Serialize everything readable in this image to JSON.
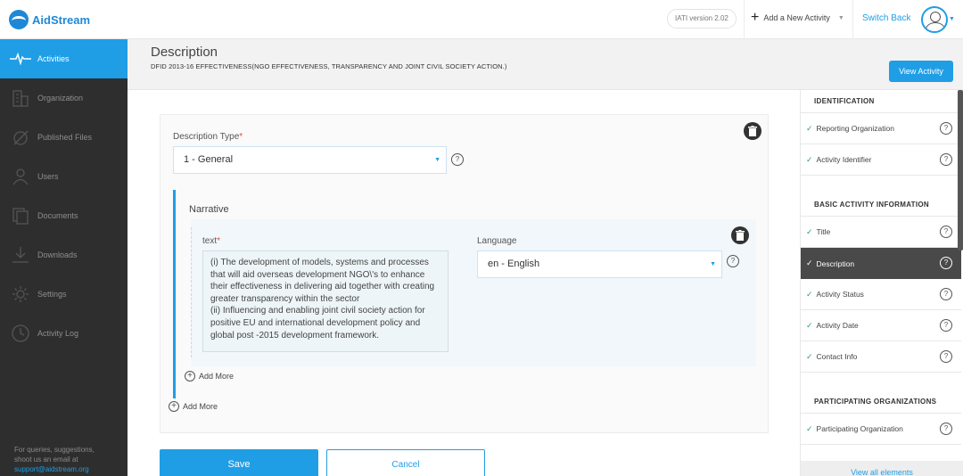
{
  "header": {
    "logo_text": "AidStream",
    "iati_version": "IATI version 2.02",
    "add_new_label": "Add a New Activity",
    "switch_back_label": "Switch Back"
  },
  "sidebar": {
    "items": [
      {
        "label": "Activities",
        "icon": "pulse-icon"
      },
      {
        "label": "Organization",
        "icon": "building-icon"
      },
      {
        "label": "Published Files",
        "icon": "published-icon"
      },
      {
        "label": "Users",
        "icon": "user-icon"
      },
      {
        "label": "Documents",
        "icon": "documents-icon"
      },
      {
        "label": "Downloads",
        "icon": "download-icon"
      },
      {
        "label": "Settings",
        "icon": "gear-icon"
      },
      {
        "label": "Activity Log",
        "icon": "clock-icon"
      }
    ],
    "footer_line1": "For queries, suggestions,",
    "footer_line2": "shoot us an email at",
    "footer_email": "support@aidstream.org"
  },
  "page": {
    "title": "Description",
    "subtitle": "DFID 2013-16 EFFECTIVENESS(NGO EFFECTIVENESS, TRANSPARENCY AND JOINT CIVIL SOCIETY ACTION.)",
    "view_activity": "View Activity"
  },
  "form": {
    "description_type_label": "Description Type",
    "description_type_value": "1 - General",
    "narrative_title": "Narrative",
    "text_label": "text",
    "text_value": "(i) The development of models, systems and processes that will aid overseas development NGO\\'s to enhance their effectiveness in delivering aid together with creating greater transparency within the sector\n(ii) Influencing and enabling joint civil society action for positive EU and international development policy and global post -2015 development framework.",
    "language_label": "Language",
    "language_value": "en - English",
    "add_more_inner": "Add More",
    "add_more_outer": "Add More",
    "save": "Save",
    "cancel": "Cancel",
    "help_mark": "?"
  },
  "right_panel": {
    "sections": [
      {
        "heading": "IDENTIFICATION",
        "items": [
          "Reporting Organization",
          "Activity Identifier"
        ]
      },
      {
        "heading": "BASIC ACTIVITY INFORMATION",
        "items": [
          "Title",
          "Description",
          "Activity Status",
          "Activity Date",
          "Contact Info"
        ]
      },
      {
        "heading": "PARTICIPATING ORGANIZATIONS",
        "items": [
          "Participating Organization"
        ]
      }
    ],
    "active_item": "Description",
    "view_all": "View all elements"
  },
  "colors": {
    "accent": "#1f9ee6",
    "sidebar_bg": "#2e2e2e",
    "active_item_bg": "#494949",
    "check": "#2ca55a"
  }
}
